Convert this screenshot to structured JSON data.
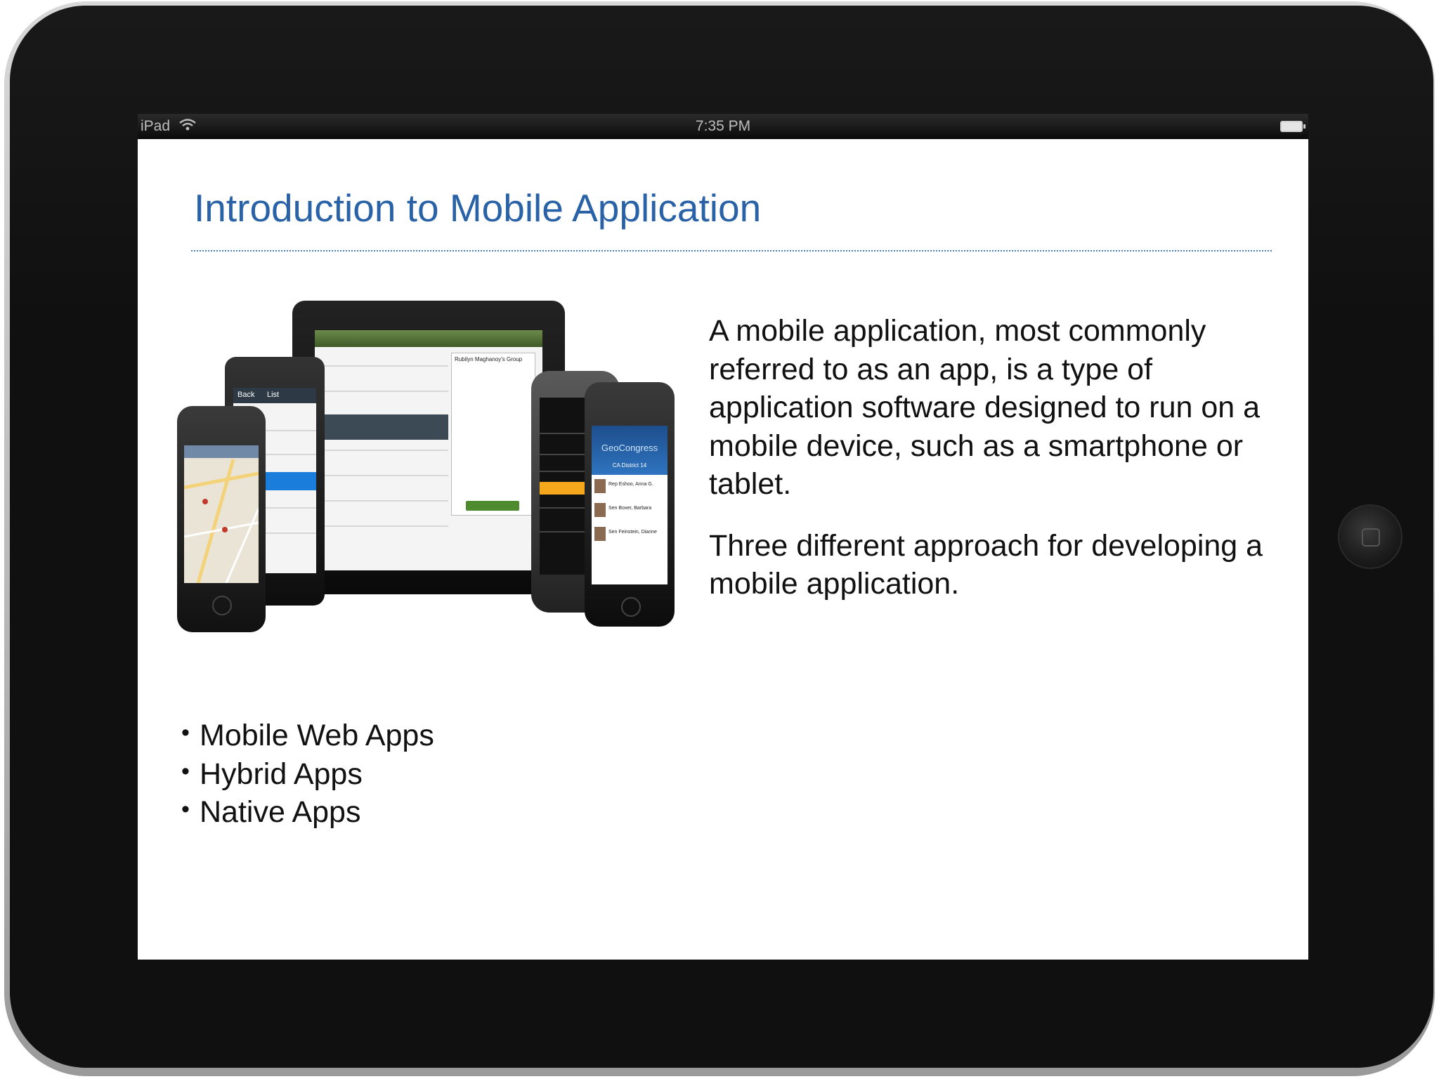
{
  "status_bar": {
    "device_name": "iPad",
    "time": "7:35 PM"
  },
  "slide": {
    "title": "Introduction to Mobile Application",
    "paragraph_1": "A mobile application, most commonly referred to as an app, is a type of application software designed to run on a mobile device, such as a smartphone or tablet.",
    "paragraph_2": "Three different approach for developing a mobile application.",
    "bullets": [
      "Mobile Web Apps",
      "Hybrid Apps",
      "Native Apps"
    ],
    "photo": {
      "tablet_header_labels": [
        "Rubilyn Maghanoy's Group"
      ],
      "phone_list_label": "List",
      "phone_back_label": "Back",
      "geo_app_name": "GeoCongress",
      "geo_district": "CA District 14",
      "geo_people": [
        "Rep Eshoo, Anna G.",
        "Sen Boxer, Barbara",
        "Sen Feinstein, Dianne"
      ]
    }
  },
  "colors": {
    "title": "#2a62a8",
    "rule": "#4a7fb5",
    "bezel": "#101010",
    "highlight_orange": "#f5a81c",
    "highlight_blue": "#1a7ddb",
    "list_green": "#4e8a2e"
  }
}
